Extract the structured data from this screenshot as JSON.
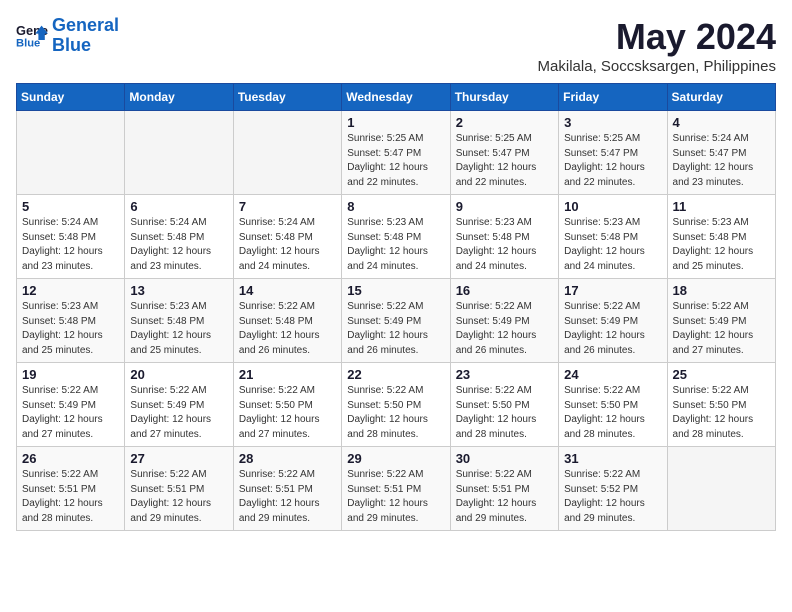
{
  "header": {
    "logo_line1": "General",
    "logo_line2": "Blue",
    "month_year": "May 2024",
    "location": "Makilala, Soccsksargen, Philippines"
  },
  "weekdays": [
    "Sunday",
    "Monday",
    "Tuesday",
    "Wednesday",
    "Thursday",
    "Friday",
    "Saturday"
  ],
  "weeks": [
    [
      {
        "day": "",
        "info": ""
      },
      {
        "day": "",
        "info": ""
      },
      {
        "day": "",
        "info": ""
      },
      {
        "day": "1",
        "info": "Sunrise: 5:25 AM\nSunset: 5:47 PM\nDaylight: 12 hours\nand 22 minutes."
      },
      {
        "day": "2",
        "info": "Sunrise: 5:25 AM\nSunset: 5:47 PM\nDaylight: 12 hours\nand 22 minutes."
      },
      {
        "day": "3",
        "info": "Sunrise: 5:25 AM\nSunset: 5:47 PM\nDaylight: 12 hours\nand 22 minutes."
      },
      {
        "day": "4",
        "info": "Sunrise: 5:24 AM\nSunset: 5:47 PM\nDaylight: 12 hours\nand 23 minutes."
      }
    ],
    [
      {
        "day": "5",
        "info": "Sunrise: 5:24 AM\nSunset: 5:48 PM\nDaylight: 12 hours\nand 23 minutes."
      },
      {
        "day": "6",
        "info": "Sunrise: 5:24 AM\nSunset: 5:48 PM\nDaylight: 12 hours\nand 23 minutes."
      },
      {
        "day": "7",
        "info": "Sunrise: 5:24 AM\nSunset: 5:48 PM\nDaylight: 12 hours\nand 24 minutes."
      },
      {
        "day": "8",
        "info": "Sunrise: 5:23 AM\nSunset: 5:48 PM\nDaylight: 12 hours\nand 24 minutes."
      },
      {
        "day": "9",
        "info": "Sunrise: 5:23 AM\nSunset: 5:48 PM\nDaylight: 12 hours\nand 24 minutes."
      },
      {
        "day": "10",
        "info": "Sunrise: 5:23 AM\nSunset: 5:48 PM\nDaylight: 12 hours\nand 24 minutes."
      },
      {
        "day": "11",
        "info": "Sunrise: 5:23 AM\nSunset: 5:48 PM\nDaylight: 12 hours\nand 25 minutes."
      }
    ],
    [
      {
        "day": "12",
        "info": "Sunrise: 5:23 AM\nSunset: 5:48 PM\nDaylight: 12 hours\nand 25 minutes."
      },
      {
        "day": "13",
        "info": "Sunrise: 5:23 AM\nSunset: 5:48 PM\nDaylight: 12 hours\nand 25 minutes."
      },
      {
        "day": "14",
        "info": "Sunrise: 5:22 AM\nSunset: 5:48 PM\nDaylight: 12 hours\nand 26 minutes."
      },
      {
        "day": "15",
        "info": "Sunrise: 5:22 AM\nSunset: 5:49 PM\nDaylight: 12 hours\nand 26 minutes."
      },
      {
        "day": "16",
        "info": "Sunrise: 5:22 AM\nSunset: 5:49 PM\nDaylight: 12 hours\nand 26 minutes."
      },
      {
        "day": "17",
        "info": "Sunrise: 5:22 AM\nSunset: 5:49 PM\nDaylight: 12 hours\nand 26 minutes."
      },
      {
        "day": "18",
        "info": "Sunrise: 5:22 AM\nSunset: 5:49 PM\nDaylight: 12 hours\nand 27 minutes."
      }
    ],
    [
      {
        "day": "19",
        "info": "Sunrise: 5:22 AM\nSunset: 5:49 PM\nDaylight: 12 hours\nand 27 minutes."
      },
      {
        "day": "20",
        "info": "Sunrise: 5:22 AM\nSunset: 5:49 PM\nDaylight: 12 hours\nand 27 minutes."
      },
      {
        "day": "21",
        "info": "Sunrise: 5:22 AM\nSunset: 5:50 PM\nDaylight: 12 hours\nand 27 minutes."
      },
      {
        "day": "22",
        "info": "Sunrise: 5:22 AM\nSunset: 5:50 PM\nDaylight: 12 hours\nand 28 minutes."
      },
      {
        "day": "23",
        "info": "Sunrise: 5:22 AM\nSunset: 5:50 PM\nDaylight: 12 hours\nand 28 minutes."
      },
      {
        "day": "24",
        "info": "Sunrise: 5:22 AM\nSunset: 5:50 PM\nDaylight: 12 hours\nand 28 minutes."
      },
      {
        "day": "25",
        "info": "Sunrise: 5:22 AM\nSunset: 5:50 PM\nDaylight: 12 hours\nand 28 minutes."
      }
    ],
    [
      {
        "day": "26",
        "info": "Sunrise: 5:22 AM\nSunset: 5:51 PM\nDaylight: 12 hours\nand 28 minutes."
      },
      {
        "day": "27",
        "info": "Sunrise: 5:22 AM\nSunset: 5:51 PM\nDaylight: 12 hours\nand 29 minutes."
      },
      {
        "day": "28",
        "info": "Sunrise: 5:22 AM\nSunset: 5:51 PM\nDaylight: 12 hours\nand 29 minutes."
      },
      {
        "day": "29",
        "info": "Sunrise: 5:22 AM\nSunset: 5:51 PM\nDaylight: 12 hours\nand 29 minutes."
      },
      {
        "day": "30",
        "info": "Sunrise: 5:22 AM\nSunset: 5:51 PM\nDaylight: 12 hours\nand 29 minutes."
      },
      {
        "day": "31",
        "info": "Sunrise: 5:22 AM\nSunset: 5:52 PM\nDaylight: 12 hours\nand 29 minutes."
      },
      {
        "day": "",
        "info": ""
      }
    ]
  ]
}
